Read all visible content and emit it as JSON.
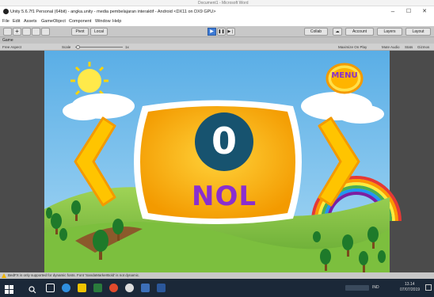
{
  "word": {
    "title": "Document1 - Microsoft Word"
  },
  "window": {
    "title": "Unity 5.6.7f1 Personal (64bit) - angka.unity - media pembelajaran interaktif - Android <DX11 on DX9 GPU>",
    "minimize": "–",
    "maximize": "☐",
    "close": "✕"
  },
  "menu": [
    "File",
    "Edit",
    "Assets",
    "GameObject",
    "Component",
    "Window",
    "Help"
  ],
  "toolbar": {
    "pivot": "Pivot",
    "local": "Local",
    "collab": "Collab",
    "cloud": "☁",
    "account": "Account",
    "layers": "Layers",
    "layout": "Layout"
  },
  "game_tab": {
    "label": "Game"
  },
  "game_bar": {
    "aspect": "Free Aspect",
    "scale_label": "Scale",
    "scale_value": "1x",
    "maximize": "Maximize On Play",
    "mute": "Mute Audio",
    "stats": "Stats",
    "gizmos": "Gizmos"
  },
  "game": {
    "menu_button": "MENU",
    "number": "0",
    "word": "NOL",
    "colors": {
      "sky": "#6fb9ea",
      "grass": "#84c447",
      "board": "#ffb400",
      "circle": "#17536f",
      "word": "#8a2fcf",
      "arrow": "#ffbf00"
    }
  },
  "status": {
    "message": "BedFX is only supported for dynamic fonts. Font 'SandaMarkerBold' is not dynamic."
  },
  "taskbar": {
    "lang": "IND",
    "time": "13.14",
    "date": "07/07/2019"
  }
}
